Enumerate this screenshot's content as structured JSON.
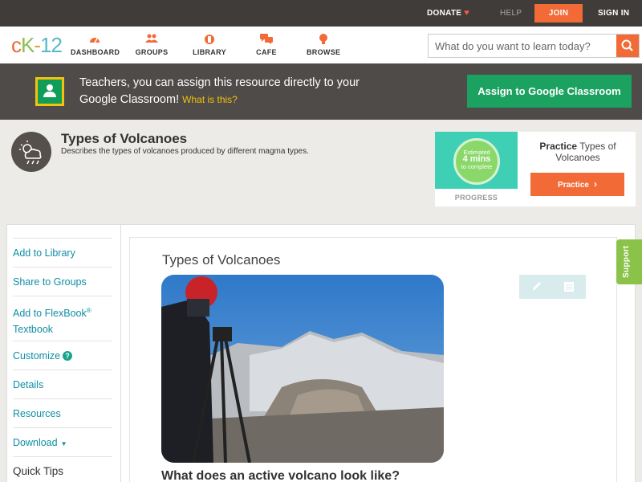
{
  "topbar": {
    "donate": "DONATE",
    "help": "HELP",
    "join": "JOIN",
    "signin": "SIGN IN"
  },
  "logo": {
    "text_c": "c",
    "text_k": "K",
    "text_dash": "-",
    "text_num": "12"
  },
  "nav": {
    "dashboard": "DASHBOARD",
    "groups": "GROUPS",
    "library": "LIBRARY",
    "cafe": "CAFE",
    "browse": "BROWSE"
  },
  "search": {
    "placeholder": "What do you want to learn today?"
  },
  "banner": {
    "text": "Teachers, you can assign this resource directly to your Google Classroom!",
    "what_is_this": "What is this?",
    "assign_button": "Assign to Google Classroom"
  },
  "concept": {
    "title": "Types of Volcanoes",
    "description": "Describes the types of volcanoes produced by different magma types."
  },
  "practice": {
    "estimated": "Estimated",
    "mins": "4 mins",
    "to_complete": "to complete",
    "progress_label": "PROGRESS",
    "title_bold": "Practice",
    "title_rest": "Types of Volcanoes",
    "button": "Practice"
  },
  "sidebar": {
    "add_to_library": "Add to Library",
    "share_to_groups": "Share to Groups",
    "add_to_flexbook_1": "Add to FlexBook",
    "add_to_flexbook_reg": "®",
    "add_to_flexbook_2": "Textbook",
    "customize": "Customize",
    "details": "Details",
    "resources": "Resources",
    "download": "Download",
    "quick_tips": "Quick Tips"
  },
  "main": {
    "title": "Types of Volcanoes",
    "subheading": "What does an active volcano look like?"
  },
  "support": "Support",
  "colors": {
    "accent": "#f26a36",
    "teal_link": "#0e8ea6",
    "google_green": "#1ba261",
    "topbar": "#3f3c39",
    "banner": "#4e4b48"
  }
}
